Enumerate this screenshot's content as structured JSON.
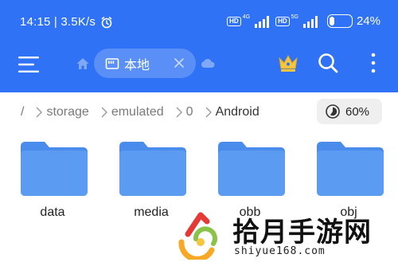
{
  "status_bar": {
    "time_speed": "14:15 | 3.5K/s",
    "alarm_icon": "alarm-clock-icon",
    "sim1": {
      "hd": "HD",
      "network": "4G"
    },
    "sim2": {
      "hd": "HD",
      "network": "5G"
    },
    "battery_percent": "24%",
    "battery_level": 0.24
  },
  "toolbar": {
    "menu_icon": "hamburger-menu-icon",
    "home_icon": "home-icon",
    "location_label": "本地",
    "location_icon": "sd-card-icon",
    "close_icon": "close-icon",
    "cloud_icon": "cloud-icon",
    "crown_icon": "crown-icon",
    "search_icon": "search-icon",
    "more_icon": "more-vertical-icon"
  },
  "breadcrumb": {
    "root": "/",
    "items": [
      "storage",
      "emulated",
      "0",
      "Android"
    ]
  },
  "storage_usage": {
    "label": "60%",
    "fraction": 0.6
  },
  "folders": [
    {
      "name": "data"
    },
    {
      "name": "media"
    },
    {
      "name": "obb"
    },
    {
      "name": "obj"
    }
  ],
  "watermark": {
    "title": "拾月手游网",
    "url": "shiyue168.com"
  },
  "colors": {
    "primary": "#2f72f5",
    "chip": "#5a8ff7",
    "folder": "#5b9cf2",
    "folder_dark": "#4a8ceb",
    "crown": "#f6c63f"
  }
}
